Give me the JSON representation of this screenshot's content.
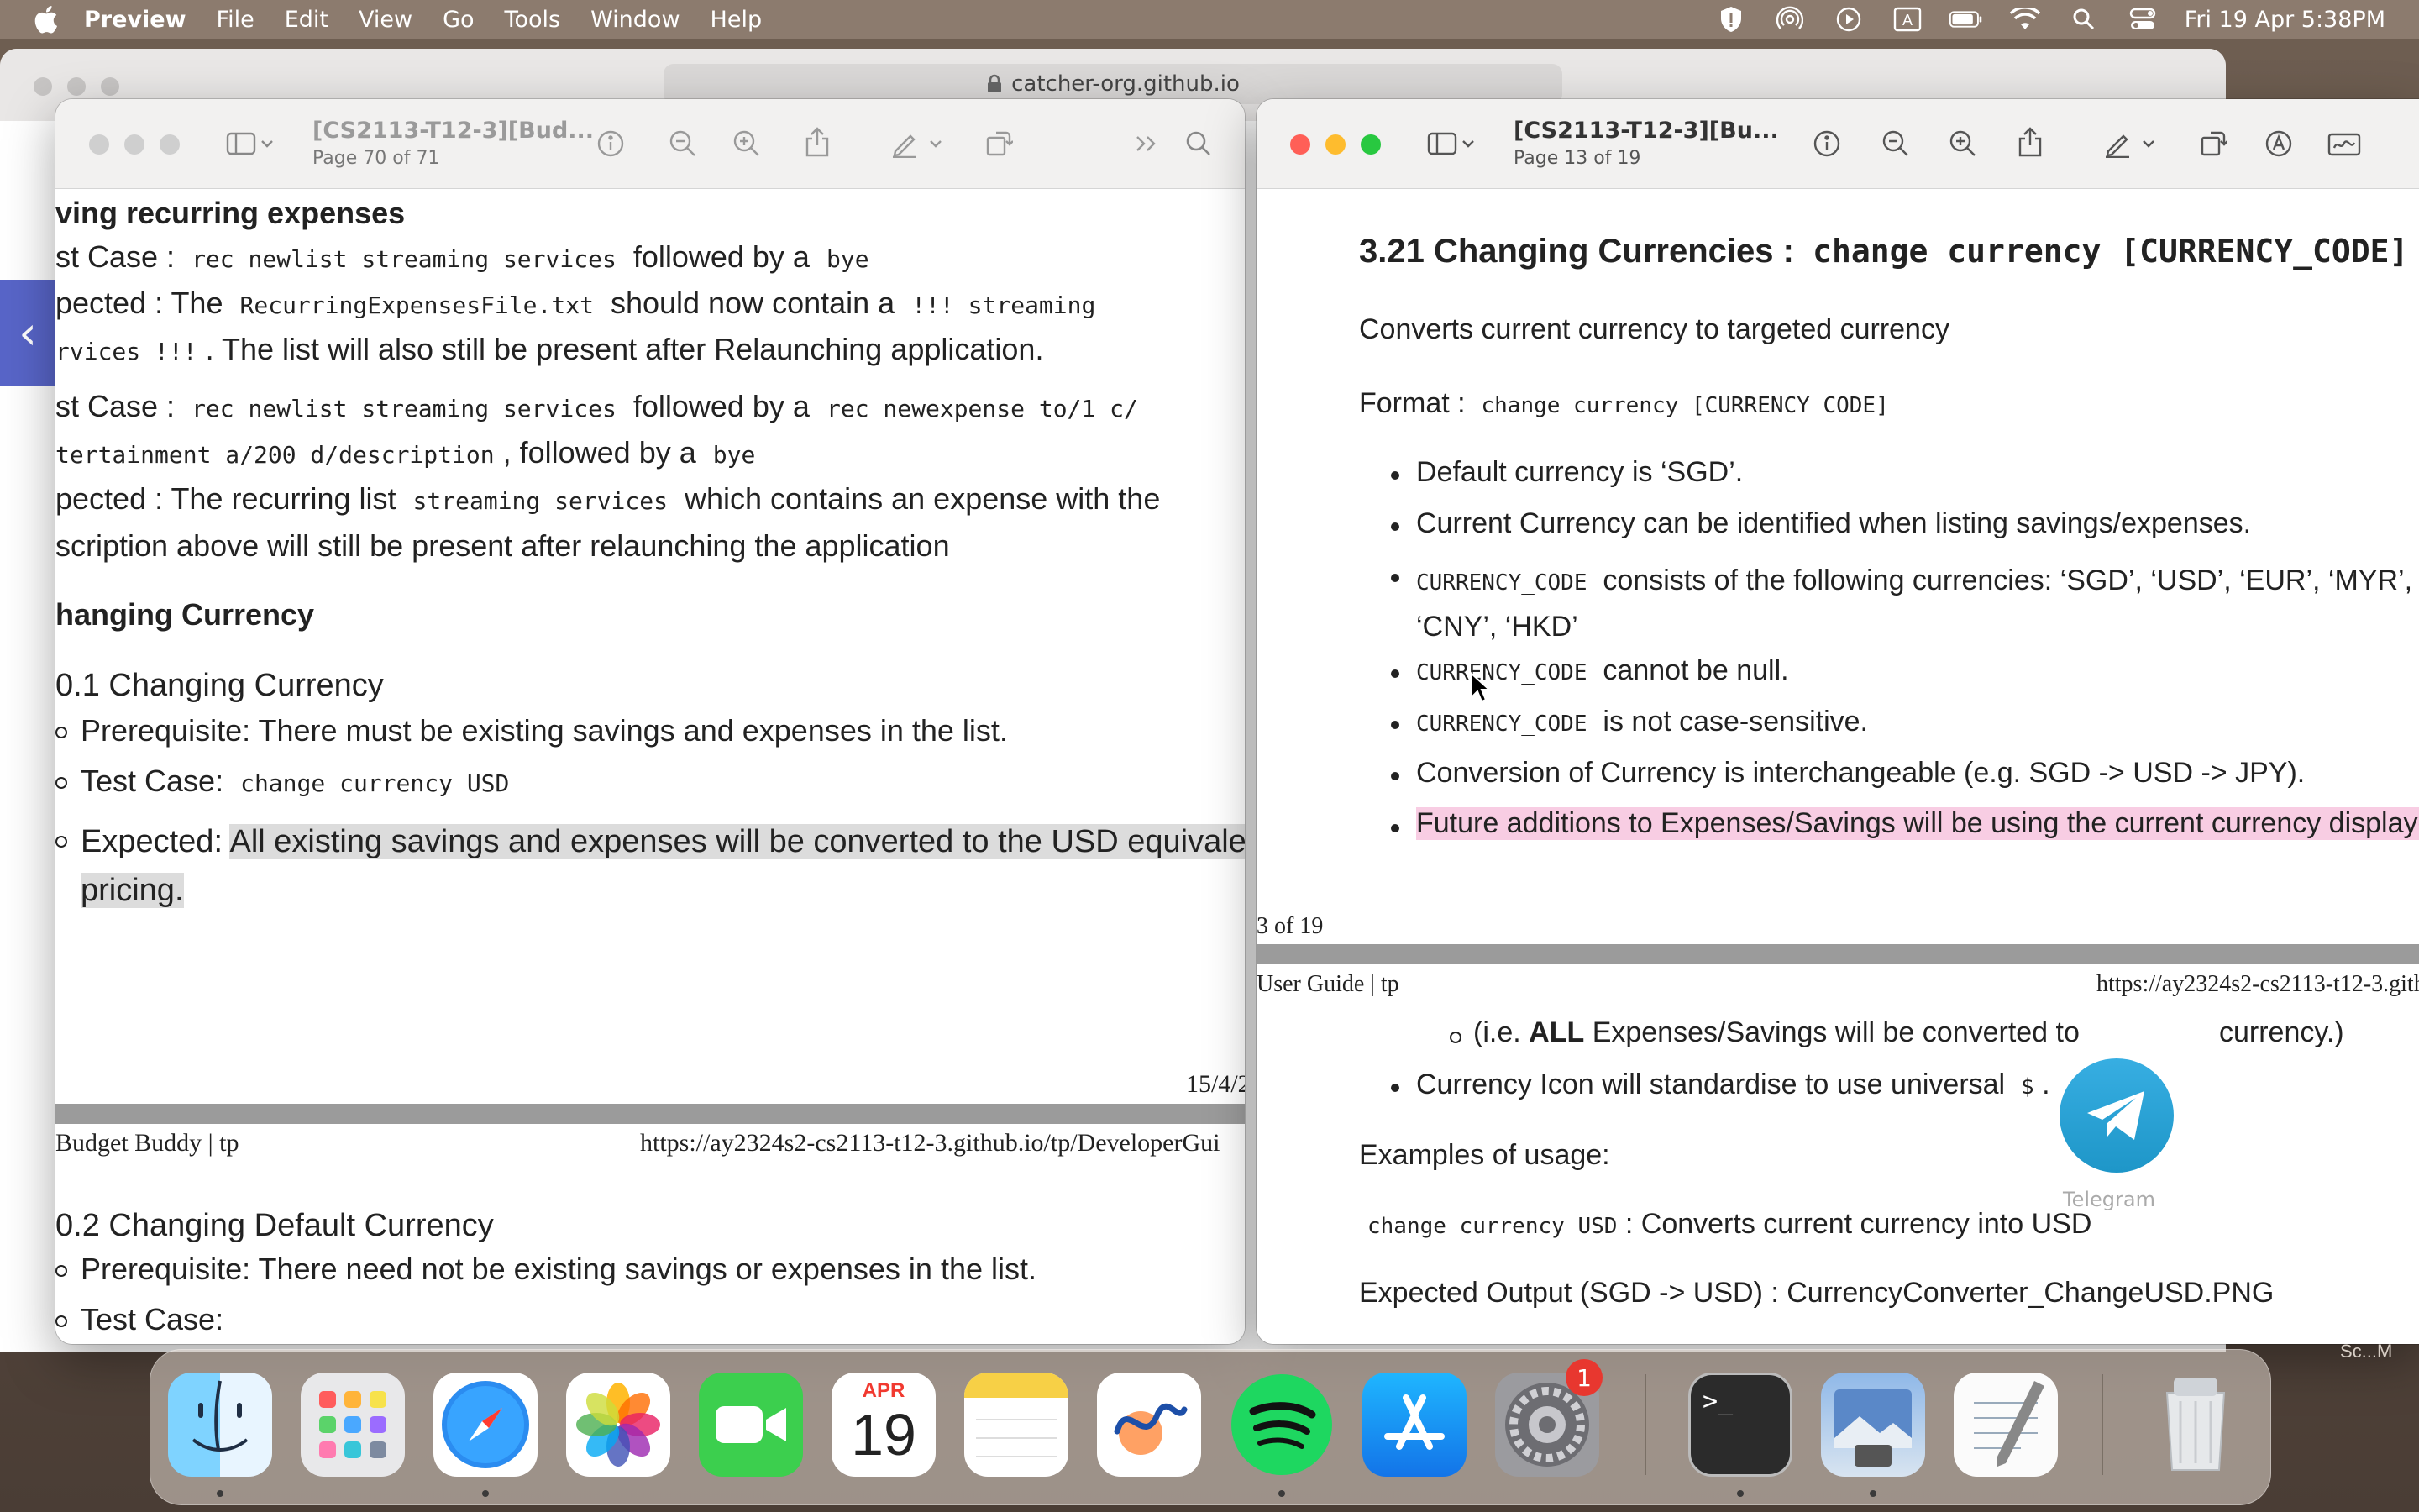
{
  "menubar": {
    "app": "Preview",
    "items": [
      "File",
      "Edit",
      "View",
      "Go",
      "Tools",
      "Window",
      "Help"
    ],
    "clock": "Fri 19 Apr  5:38PM"
  },
  "safari": {
    "url": "catcher-org.github.io"
  },
  "left_window": {
    "title": "[CS2113-T12-3][Bud...",
    "page_label": "Page 70 of 71",
    "heading1": "ving recurring expenses",
    "l1_a": "st Case :",
    "l1_code1": "rec newlist streaming services",
    "l1_b": "followed by a",
    "l1_code2": "bye",
    "l2_a": "pected : The",
    "l2_code1": "RecurringExpensesFile.txt",
    "l2_b": "should now contain a",
    "l2_code2": "!!! streaming",
    "l3_code": "rvices !!!",
    "l3_b": ". The list will also still be present after Relaunching application.",
    "l4_a": "st Case :",
    "l4_code1": "rec newlist streaming services",
    "l4_b": "followed by a",
    "l4_code2": "rec newexpense to/1 c/",
    "l5_code1": "tertainment a/200 d/description",
    "l5_b": ", followed by a",
    "l5_code2": "bye",
    "l6_a": "pected : The recurring list",
    "l6_code": "streaming services",
    "l6_b": "which contains an expense with the",
    "l7": "scription above will still be present after relaunching the application",
    "heading2": "hanging Currency",
    "sub1": "0.1 Changing Currency",
    "b1": "Prerequisite: There must be existing savings and expenses in the list.",
    "b2_a": "Test Case:",
    "b2_code": "change currency USD",
    "b3_a": "Expected:",
    "b3_hl": "All existing savings and expenses will be converted to the USD equivalent",
    "b3_hl2": "pricing.",
    "footer_date": "15/4/2",
    "header_left": "Budget Buddy | tp",
    "header_right": "https://ay2324s2-cs2113-t12-3.github.io/tp/DeveloperGui",
    "sub2": "0.2 Changing Default Currency",
    "b4": "Prerequisite: There need not be existing savings or expenses in the list.",
    "b5_partial": "Test Case:"
  },
  "right_window": {
    "title": "[CS2113-T12-3][Bu...",
    "page_label": "Page 13 of 19",
    "section_title": "3.21 Changing Currencies :",
    "section_code": "change currency [CURRENCY_CODE]",
    "desc": "Converts current currency to targeted currency",
    "format_label": "Format :",
    "format_code": "change currency [CURRENCY_CODE]",
    "bullets": [
      "Default currency is ‘SGD’.",
      "Current Currency can be identified when listing savings/expenses."
    ],
    "b3_code": "CURRENCY_CODE",
    "b3_text": "consists of the following currencies: ‘SGD’, ‘USD’, ‘EUR’, ‘MYR’, ‘J",
    "b3_text2": "‘CNY’, ‘HKD’",
    "b4_code": "CURRENCY_CODE",
    "b4_text": "cannot be null.",
    "b5_code": "CURRENCY_CODE",
    "b5_text": "is not case-sensitive.",
    "b6": "Conversion of Currency is interchangeable (e.g. SGD -> USD -> JPY).",
    "b7": "Future additions to Expenses/Savings will be using the current currency displaye",
    "page_footer": "3 of 19",
    "header_left": "User Guide | tp",
    "header_right": "https://ay2324s2-cs2113-t12-3.gith",
    "sub_a": "(i.e.",
    "sub_bold": "ALL",
    "sub_b": "Expenses/Savings will be converted to",
    "sub_c": "currency.)",
    "b8_a": "Currency Icon will standardise to use universal",
    "b8_code": "$",
    "b8_b": ".",
    "examples": "Examples of usage:",
    "ex_code": "change currency USD",
    "ex_text": ": Converts current currency into USD",
    "expected": "Expected Output (SGD -> USD) : CurrencyConverter_ChangeUSD.PNG"
  },
  "overlay": {
    "telegram_label": "Telegram",
    "screenshot_label": "Sc...M"
  },
  "dock": {
    "calendar_month": "APR",
    "calendar_day": "19",
    "settings_badge": "1",
    "apps": [
      "Finder",
      "Launchpad",
      "Safari",
      "Photos",
      "FaceTime",
      "Calendar",
      "Notes",
      "Freeform",
      "Spotify",
      "App Store",
      "System Settings",
      "Terminal",
      "Preview",
      "TextEdit",
      "Trash"
    ]
  },
  "colors": {
    "menubar": "#8c7b6e",
    "highlight_pink": "#f8cde3",
    "highlight_grey": "#dcdcdc"
  }
}
